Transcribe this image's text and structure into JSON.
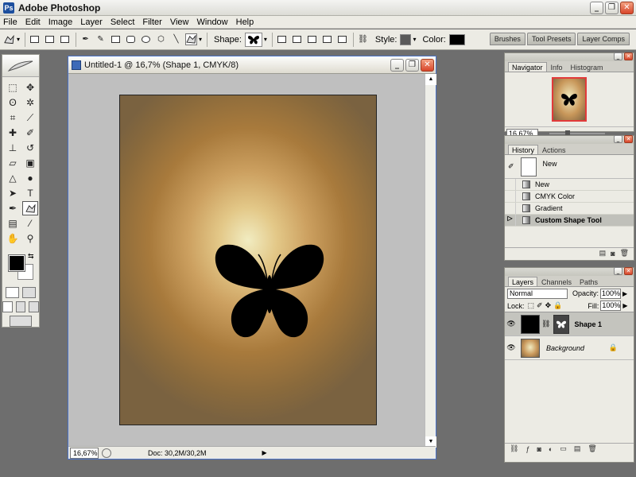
{
  "app": {
    "title": "Adobe Photoshop",
    "icon_letter": "Ps"
  },
  "window_buttons": {
    "minimize": "_",
    "maximize": "❐",
    "close": "✕"
  },
  "menu": [
    "File",
    "Edit",
    "Image",
    "Layer",
    "Select",
    "Filter",
    "View",
    "Window",
    "Help"
  ],
  "options_bar": {
    "shape_label": "Shape:",
    "style_label": "Style:",
    "color_label": "Color:",
    "color_value": "#000000",
    "palette_well": [
      "Brushes",
      "Tool Presets",
      "Layer Comps"
    ]
  },
  "document": {
    "title": "Untitled-1 @ 16,7% (Shape 1, CMYK/8)",
    "zoom": "16,67%",
    "doc_info": "Doc: 30,2M/30,2M"
  },
  "navigator": {
    "tabs": [
      "Navigator",
      "Info",
      "Histogram"
    ],
    "zoom": "16.67%"
  },
  "history": {
    "tabs": [
      "History",
      "Actions"
    ],
    "snapshot_label": "New",
    "items": [
      {
        "label": "New",
        "selected": false
      },
      {
        "label": "CMYK Color",
        "selected": false
      },
      {
        "label": "Gradient",
        "selected": false
      },
      {
        "label": "Custom Shape Tool",
        "selected": true
      }
    ]
  },
  "layers": {
    "tabs": [
      "Layers",
      "Channels",
      "Paths"
    ],
    "blend_mode": "Normal",
    "opacity_label": "Opacity:",
    "opacity": "100%",
    "lock_label": "Lock:",
    "fill_label": "Fill:",
    "fill": "100%",
    "items": [
      {
        "name": "Shape 1",
        "selected": true
      },
      {
        "name": "Background",
        "selected": false
      }
    ]
  }
}
